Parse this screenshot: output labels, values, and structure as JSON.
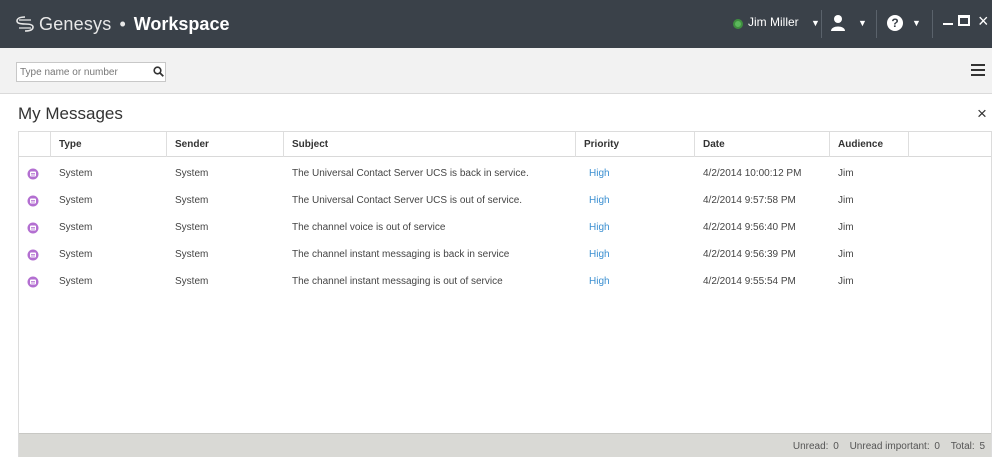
{
  "titlebar": {
    "brand": "Genesys",
    "separator": "•",
    "app": "Workspace",
    "user_name": "Jim Miller",
    "user_status_color": "#5cb85c",
    "icons": [
      "genesys-logo-icon",
      "status-available-icon",
      "agent-icon",
      "help-icon",
      "minimize-icon",
      "maximize-icon",
      "close-icon"
    ]
  },
  "search": {
    "placeholder": "Type name or number",
    "value": ""
  },
  "panel": {
    "title": "My Messages",
    "close": "×"
  },
  "table": {
    "columns": [
      "Type",
      "Sender",
      "Subject",
      "Priority",
      "Date",
      "Audience"
    ],
    "rows": [
      {
        "type": "System",
        "sender": "System",
        "subject": "The Universal Contact Server UCS is back in service.",
        "priority": "High",
        "date": "4/2/2014 10:00:12 PM",
        "audience": "Jim"
      },
      {
        "type": "System",
        "sender": "System",
        "subject": "The Universal Contact Server UCS is out of service.",
        "priority": "High",
        "date": "4/2/2014 9:57:58 PM",
        "audience": "Jim"
      },
      {
        "type": "System",
        "sender": "System",
        "subject": "The channel voice is out of service",
        "priority": "High",
        "date": "4/2/2014 9:56:40 PM",
        "audience": "Jim"
      },
      {
        "type": "System",
        "sender": "System",
        "subject": "The channel instant messaging is back in service",
        "priority": "High",
        "date": "4/2/2014 9:56:39 PM",
        "audience": "Jim"
      },
      {
        "type": "System",
        "sender": "System",
        "subject": "The channel instant messaging is out of service",
        "priority": "High",
        "date": "4/2/2014 9:55:54 PM",
        "audience": "Jim"
      }
    ]
  },
  "footer": {
    "unread_label": "Unread:",
    "unread_value": "0",
    "important_label": "Unread important:",
    "important_value": "0",
    "total_label": "Total:",
    "total_value": "5"
  },
  "colors": {
    "titlebar": "#3a4149",
    "priority_high": "#3b8fd1",
    "message_icon": "#b36fd1"
  }
}
